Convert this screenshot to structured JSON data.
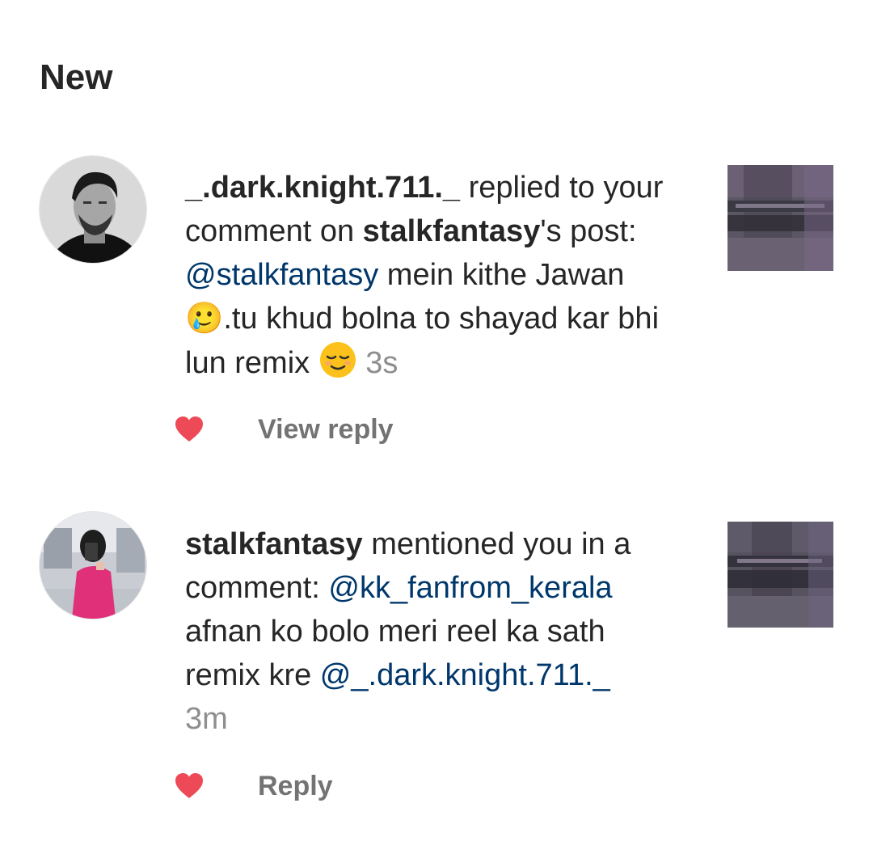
{
  "section_title": "New",
  "notifications": [
    {
      "username": "_.dark.knight.711._",
      "action_text": " replied to your comment on ",
      "target_user": "stalkfantasy",
      "suffix": "'s post: ",
      "mention": "@stalkfantasy",
      "message": " mein kithe Jawan 🥲.tu khud bolna to shayad kar bhi lun remix ",
      "emoji_icon": "relieved-face-emoji",
      "time": "3s",
      "action_label": "View reply"
    },
    {
      "username": "stalkfantasy",
      "action_text": " mentioned you in a comment: ",
      "mention": "@kk_fanfrom_kerala",
      "message": " afnan ko bolo meri reel ka sath remix kre ",
      "mention2": "@_.dark.knight.711._",
      "time": "3m",
      "action_label": "Reply"
    }
  ],
  "colors": {
    "text": "#262626",
    "mention": "#00376b",
    "secondary": "#8e8e8e",
    "heart": "#ed4956",
    "action": "#737373"
  }
}
